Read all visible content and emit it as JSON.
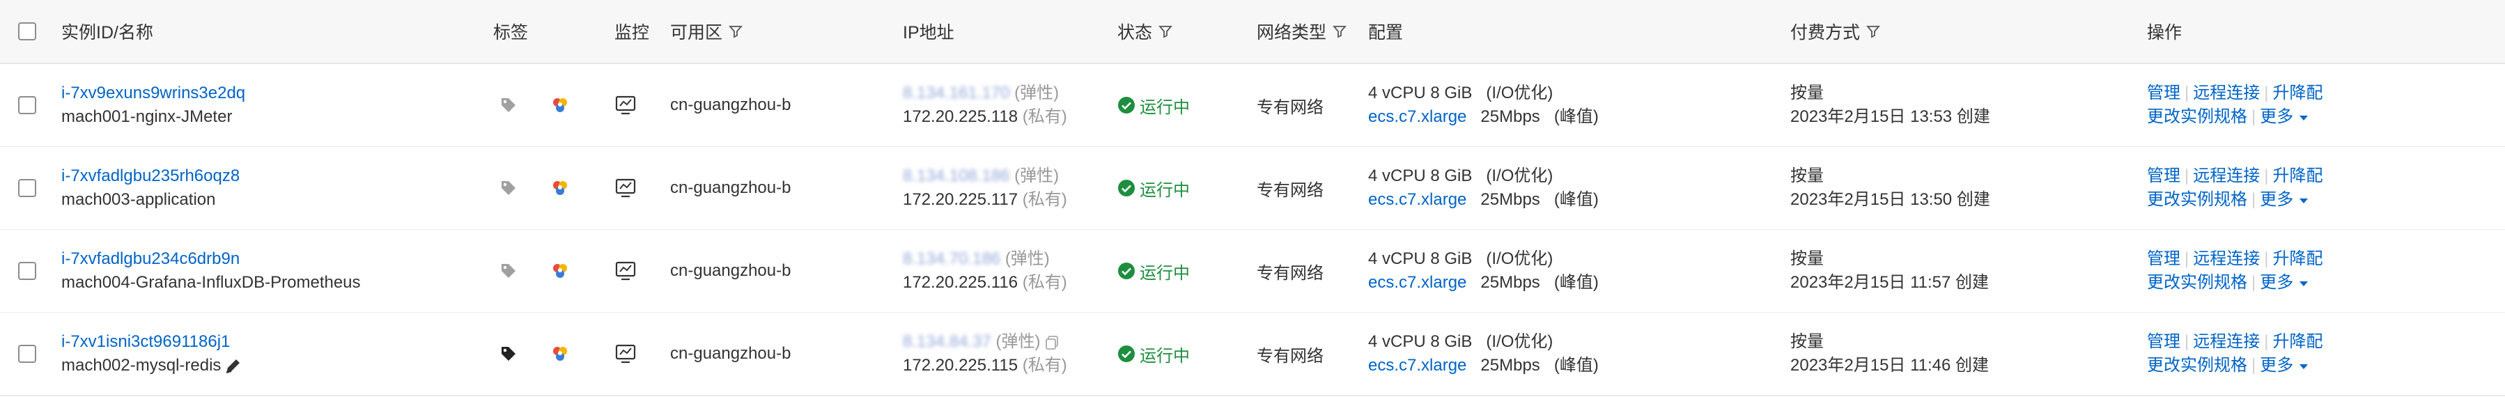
{
  "header": {
    "instance": "实例ID/名称",
    "tags": "标签",
    "monitor": "监控",
    "zone": "可用区",
    "ip": "IP地址",
    "status": "状态",
    "network": "网络类型",
    "config": "配置",
    "billing": "付费方式",
    "actions": "操作"
  },
  "rows": [
    {
      "id": "i-7xv9exuns9wrins3e2dq",
      "name": "mach001-nginx-JMeter",
      "zone": "cn-guangzhou-b",
      "public_ip": "8.134.161.170",
      "public_tag": "(弹性)",
      "private_ip": "172.20.225.118",
      "private_tag": "(私有)",
      "status": "运行中",
      "network": "专有网络",
      "spec": "4 vCPU 8 GiB",
      "io": "(I/O优化)",
      "instance_type": "ecs.c7.xlarge",
      "bandwidth": "25Mbps",
      "bandwidth_note": "(峰值)",
      "billing_type": "按量",
      "created": "2023年2月15日 13:53 创建",
      "action_manage": "管理",
      "action_remote": "远程连接",
      "action_upgrade": "升降配",
      "action_change": "更改实例规格",
      "action_more": "更多"
    },
    {
      "id": "i-7xvfadlgbu235rh6oqz8",
      "name": "mach003-application",
      "zone": "cn-guangzhou-b",
      "public_ip": "8.134.108.186",
      "public_tag": "(弹性)",
      "private_ip": "172.20.225.117",
      "private_tag": "(私有)",
      "status": "运行中",
      "network": "专有网络",
      "spec": "4 vCPU 8 GiB",
      "io": "(I/O优化)",
      "instance_type": "ecs.c7.xlarge",
      "bandwidth": "25Mbps",
      "bandwidth_note": "(峰值)",
      "billing_type": "按量",
      "created": "2023年2月15日 13:50 创建",
      "action_manage": "管理",
      "action_remote": "远程连接",
      "action_upgrade": "升降配",
      "action_change": "更改实例规格",
      "action_more": "更多"
    },
    {
      "id": "i-7xvfadlgbu234c6drb9n",
      "name": "mach004-Grafana-InfluxDB-Prometheus",
      "zone": "cn-guangzhou-b",
      "public_ip": "8.134.70.186",
      "public_tag": "(弹性)",
      "private_ip": "172.20.225.116",
      "private_tag": "(私有)",
      "status": "运行中",
      "network": "专有网络",
      "spec": "4 vCPU 8 GiB",
      "io": "(I/O优化)",
      "instance_type": "ecs.c7.xlarge",
      "bandwidth": "25Mbps",
      "bandwidth_note": "(峰值)",
      "billing_type": "按量",
      "created": "2023年2月15日 11:57 创建",
      "action_manage": "管理",
      "action_remote": "远程连接",
      "action_upgrade": "升降配",
      "action_change": "更改实例规格",
      "action_more": "更多"
    },
    {
      "id": "i-7xv1isni3ct9691186j1",
      "name": "mach002-mysql-redis",
      "zone": "cn-guangzhou-b",
      "public_ip": "8.134.84.37",
      "public_tag": "(弹性)",
      "private_ip": "172.20.225.115",
      "private_tag": "(私有)",
      "status": "运行中",
      "network": "专有网络",
      "spec": "4 vCPU 8 GiB",
      "io": "(I/O优化)",
      "instance_type": "ecs.c7.xlarge",
      "bandwidth": "25Mbps",
      "bandwidth_note": "(峰值)",
      "billing_type": "按量",
      "created": "2023年2月15日 11:46 创建",
      "action_manage": "管理",
      "action_remote": "远程连接",
      "action_upgrade": "升降配",
      "action_change": "更改实例规格",
      "action_more": "更多"
    }
  ],
  "colors": {
    "link": "#0064c8",
    "running": "#1e8e3e",
    "muted": "#999999",
    "header_bg": "#f7f7f7"
  },
  "icons": [
    "tag-icon",
    "colorful-tag-icon",
    "monitor-icon",
    "filter-icon",
    "check-circle-icon",
    "copy-icon",
    "edit-icon",
    "caret-down-icon"
  ]
}
